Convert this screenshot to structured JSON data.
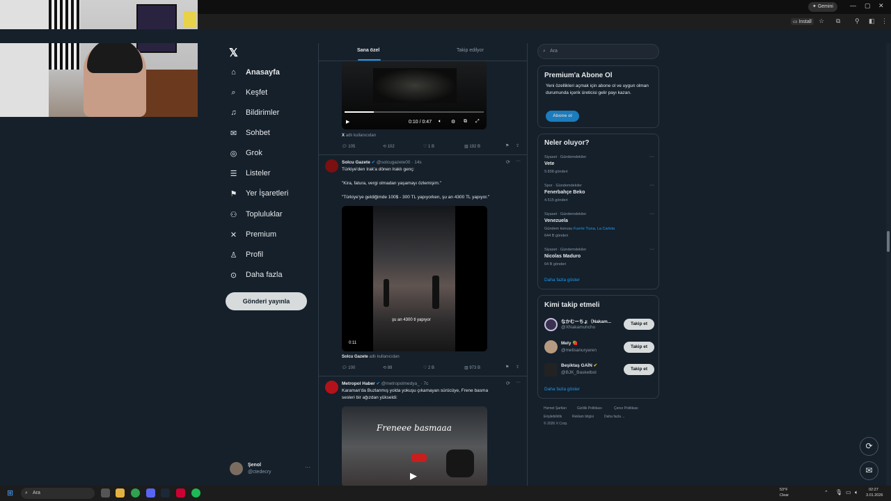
{
  "browser": {
    "gemini_label": "Gemini",
    "install_label": "Install"
  },
  "nav": {
    "items": [
      {
        "label": "Anasayfa",
        "icon": "home-icon",
        "glyph": "⌂"
      },
      {
        "label": "Keşfet",
        "icon": "search-icon",
        "glyph": "⌕"
      },
      {
        "label": "Bildirimler",
        "icon": "bell-icon",
        "glyph": "♫"
      },
      {
        "label": "Sohbet",
        "icon": "mail-icon",
        "glyph": "✉"
      },
      {
        "label": "Grok",
        "icon": "grok-icon",
        "glyph": "◎"
      },
      {
        "label": "Listeler",
        "icon": "list-icon",
        "glyph": "☰"
      },
      {
        "label": "Yer İşaretleri",
        "icon": "bookmark-icon",
        "glyph": "⚑"
      },
      {
        "label": "Topluluklar",
        "icon": "communities-icon",
        "glyph": "⚇"
      },
      {
        "label": "Premium",
        "icon": "x-premium-icon",
        "glyph": "✕"
      },
      {
        "label": "Profil",
        "icon": "profile-icon",
        "glyph": "♙"
      },
      {
        "label": "Daha fazla",
        "icon": "more-icon",
        "glyph": "⊙"
      }
    ],
    "post_button": "Gönderi yayınla",
    "profile_name": "Şenol",
    "profile_handle": "@ctedecry"
  },
  "timeline": {
    "tabs": [
      "Sana özel",
      "Takip edilyor"
    ],
    "post1": {
      "video_time": "0:10 / 0:47",
      "source_prefix": "X",
      "source_text": "adlı kullanıcıdan",
      "stats": {
        "replies": "105",
        "reposts": "102",
        "likes": "1 B",
        "views": "192 B"
      }
    },
    "post2": {
      "author": "Solcu Gazete",
      "handle": "@solcugazete00 · 14s",
      "lines": [
        "Türkiye'den Irak'a dönen Iraklı genç:",
        "\"Kira, fatura, vergi olmadan yaşamayı özlemişim.\"",
        "\"Türkiye'ye geldiğimde 100$ - 300 TL yapıyorken, şu an 4300 TL yapıyor.\""
      ],
      "video_caption": "şu an 4300 tl yapıyor",
      "video_time": "0:11",
      "source_name": "Solcu Gazete",
      "source_text": "adlı kullanıcıdan",
      "stats": {
        "replies": "100",
        "reposts": "89",
        "likes": "2 B",
        "views": "973 B"
      }
    },
    "post3": {
      "author": "Metropol Haber",
      "handle": "@metropolmedya_ · 7c",
      "lines": [
        "Karaman'da Buzlanmış yolda yokuşu çıkamayan sürücüye, Frene basma",
        "sesleri bir ağızdan yükseldi:"
      ],
      "video_caption": "Freneee basmaaa"
    }
  },
  "right": {
    "search_placeholder": "Ara",
    "premium": {
      "title": "Premium'a Abone Ol",
      "text": "Yeni özellikleri açmak için abone ol ve uygun olman durumunda içerik üreticisi gelir payı kazan.",
      "button": "Abone ol"
    },
    "trends": {
      "title": "Neler oluyor?",
      "items": [
        {
          "category": "Siyaset · Gündemdekiler",
          "name": "Vete",
          "count": "9.838 gönderi",
          "extra": ""
        },
        {
          "category": "Spor · Gündemdekiler",
          "name": "Fenerbahçe Beko",
          "count": "4.515 gönderi",
          "extra": ""
        },
        {
          "category": "Siyaset · Gündemdekiler",
          "name": "Venezuela",
          "count": "644 B gönderi",
          "extra_prefix": "Gündem konusu",
          "extra_links": "Fuerte Tiuna, La Carlota"
        },
        {
          "category": "Siyaset · Gündemdekiler",
          "name": "Nicolas Maduro",
          "count": "64 B gönderi",
          "extra": ""
        }
      ],
      "show_more": "Daha fazla göster"
    },
    "who": {
      "title": "Kimi takip etmeli",
      "items": [
        {
          "name": "なかむーちょ（Nakam...",
          "handle": "@XNakamuhcho",
          "button": "Takip et",
          "color": "#3a3050"
        },
        {
          "name": "Mely 🍓",
          "handle": "@melisanuryaren",
          "button": "Takip et",
          "color": "#b59a80"
        },
        {
          "name": "Beşiktaş GAİN",
          "handle": "@BJK_Basketbol",
          "button": "Takip et",
          "color": "#222222"
        }
      ],
      "show_more": "Daha fazla göster"
    },
    "footer": [
      "Hizmet Şartları",
      "Gizlilik Politikası",
      "Çerez Politikası",
      "Erişilebilirlik",
      "Reklam bilgisi",
      "Daha fazla ...",
      "© 2026 X Corp."
    ]
  },
  "taskbar": {
    "search": "Ara",
    "weather_temp": "53°F",
    "weather_desc": "Clear",
    "time": "02:27",
    "date": "3.01.2026"
  }
}
